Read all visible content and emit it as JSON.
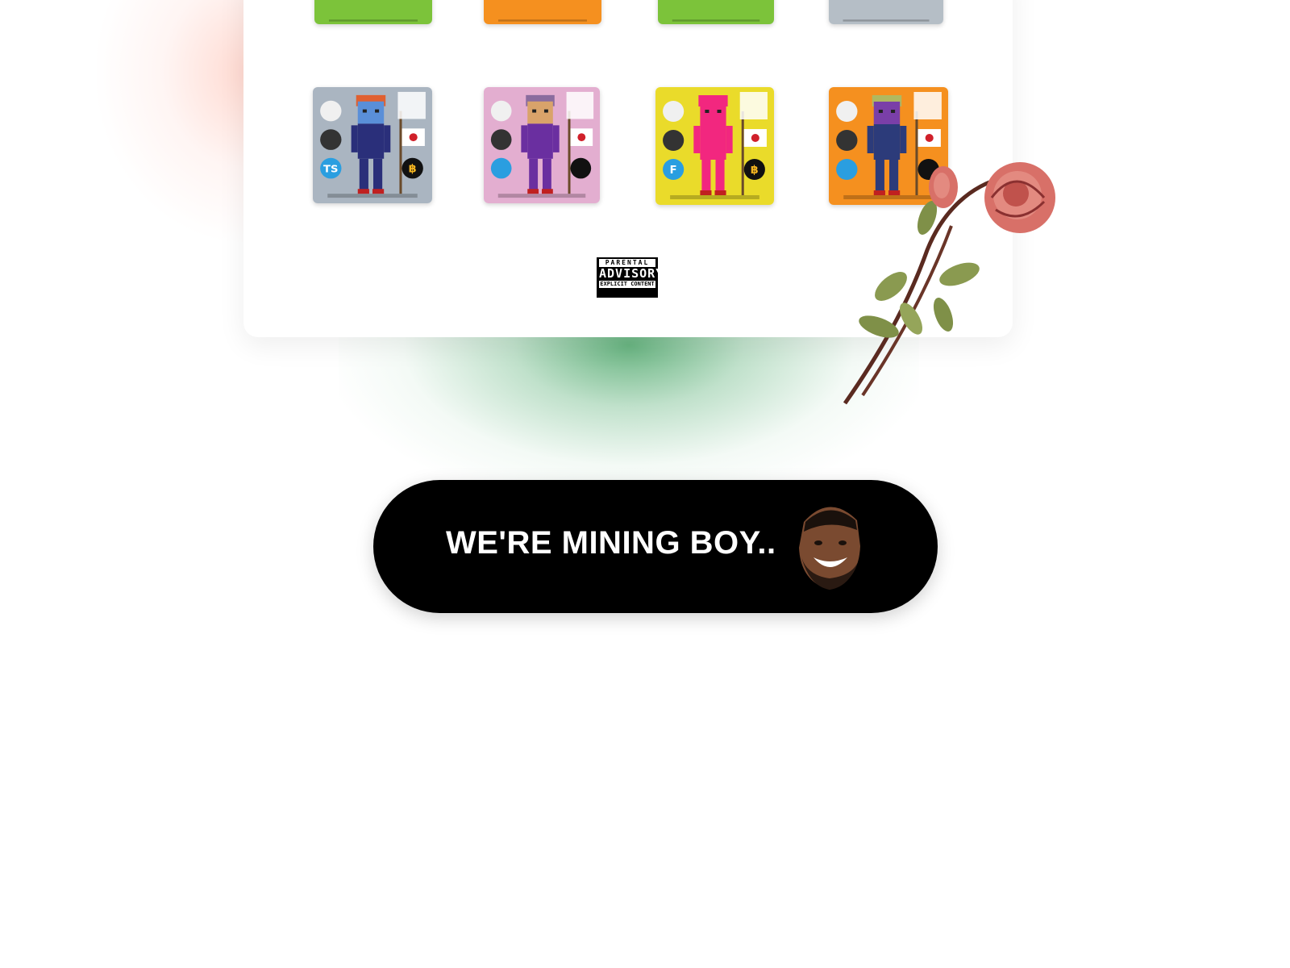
{
  "top_tiles": [
    {
      "name": "avatar-card-top-1",
      "bg": "#7cc33a"
    },
    {
      "name": "avatar-card-top-2",
      "bg": "#f5901f"
    },
    {
      "name": "avatar-card-top-3",
      "bg": "#7cc33a"
    },
    {
      "name": "avatar-card-top-4",
      "bg": "#b5bec6"
    }
  ],
  "avatar_tiles": [
    {
      "name": "avatar-card-1",
      "bg": "#aab5c1",
      "skin": "#5a8fd8",
      "hair": "#e06030",
      "outfit": "#2a2f7a",
      "badges": [
        "video-badge",
        "bitcoin-badge",
        "typescript-badge",
        "baht-badge"
      ],
      "badge_text": [
        "",
        "",
        "TS",
        "฿"
      ]
    },
    {
      "name": "avatar-card-2",
      "bg": "#e3aed0",
      "skin": "#d9a36a",
      "hair": "#8a6c9e",
      "outfit": "#6a2fa0",
      "badges": [
        "docker-badge",
        "fish-badge",
        "vue-badge",
        "key-badge"
      ],
      "badge_text": [
        "",
        "",
        "",
        ""
      ]
    },
    {
      "name": "avatar-card-3",
      "bg": "#eadb2a",
      "skin": "#f2277f",
      "hair": "#f2277f",
      "outfit": "#f2277f",
      "badges": [
        "video-badge",
        "dashboard-badge",
        "fsharp-badge",
        "baht-badge"
      ],
      "badge_text": [
        "",
        "",
        "F",
        "฿"
      ]
    },
    {
      "name": "avatar-card-4",
      "bg": "#f5901f",
      "skin": "#7a3fa8",
      "hair": "#b0b860",
      "outfit": "#2c3b7a",
      "badges": [
        "search-badge",
        "bulb-badge",
        "vuejs-badge",
        "mask-badge"
      ],
      "badge_text": [
        "",
        "",
        "",
        ""
      ]
    }
  ],
  "advisory": {
    "line1": "PARENTAL",
    "line2": "ADVISORY",
    "line3": "EXPLICIT CONTENT"
  },
  "cta": {
    "label": "WE'RE MINING BOY.."
  },
  "colors": {
    "accent_green": "#60b07a",
    "cta_bg": "#000000",
    "rose": "#d87068"
  }
}
